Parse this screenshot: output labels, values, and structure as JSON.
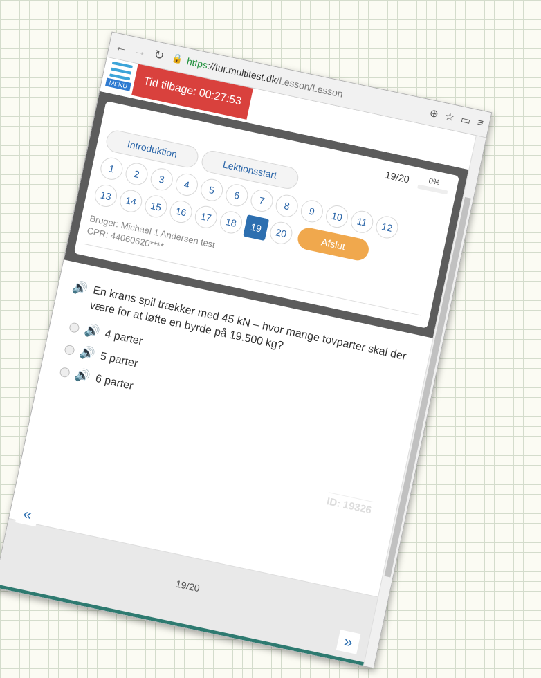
{
  "browser": {
    "url_scheme": "https",
    "url_host": "://tur.multitest.dk",
    "url_path": "/Lesson/Lesson"
  },
  "app": {
    "menu_label": "MENU",
    "timer": "Tid tilbage: 00:27:53"
  },
  "navigation": {
    "progress_count": "19/20",
    "progress_percent_label": "0%",
    "progress_fraction": 0,
    "chips": [
      "Introduktion",
      "Lektionsstart"
    ],
    "question_numbers_row1": [
      "1",
      "2",
      "3",
      "4",
      "5",
      "6",
      "7",
      "8",
      "9",
      "10",
      "11",
      "12"
    ],
    "question_numbers_row2": [
      "13",
      "14",
      "15",
      "16",
      "17",
      "18",
      "19",
      "20"
    ],
    "current_question": "19",
    "finish_label": "Afslut"
  },
  "user": {
    "line1": "Bruger: Michael 1 Andersen test",
    "line2": "CPR: 44060620****"
  },
  "question": {
    "text": "En krans spil trækker med 45 kN – hvor mange tovparter skal der være for at løfte en byrde på 19.500 kg?",
    "answers": [
      "4 parter",
      "5 parter",
      "6 parter"
    ],
    "id_label": "ID: 19326"
  },
  "footer": {
    "page_count": "19/20"
  }
}
